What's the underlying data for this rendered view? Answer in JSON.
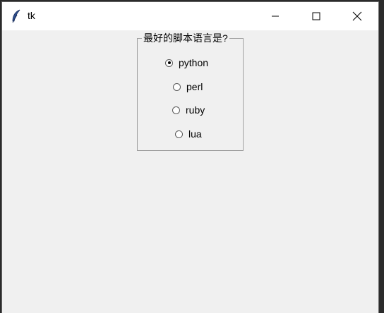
{
  "window": {
    "title": "tk"
  },
  "group": {
    "title": "最好的脚本语言是?"
  },
  "options": [
    {
      "label": "python",
      "selected": true
    },
    {
      "label": "perl",
      "selected": false
    },
    {
      "label": "ruby",
      "selected": false
    },
    {
      "label": "lua",
      "selected": false
    }
  ],
  "icons": {
    "app": "feather-icon",
    "minimize": "minimize-icon",
    "maximize": "maximize-icon",
    "close": "close-icon"
  }
}
